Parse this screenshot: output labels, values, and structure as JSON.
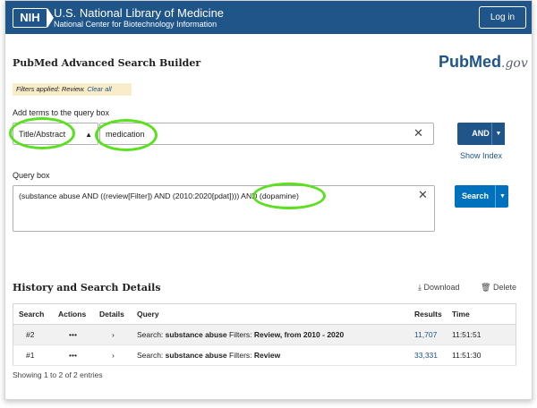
{
  "header": {
    "logo_text": "NIH",
    "title": "U.S. National Library of Medicine",
    "subtitle": "National Center for Biotechnology Information",
    "login_label": "Log in"
  },
  "builder": {
    "page_title": "PubMed Advanced Search Builder",
    "logo_pub": "Pub",
    "logo_med": "Med",
    "logo_gov": ".gov",
    "filters_applied": "Filters applied: Review.",
    "clear_all": "Clear all",
    "add_terms_label": "Add terms to the query box",
    "field_value": "Title/Abstract",
    "term_value": "medication",
    "operator_label": "AND",
    "show_index_label": "Show Index",
    "query_box_label": "Query box",
    "query_value": "(substance abuse AND ((review[Filter]) AND (2010:2020[pdat]))) AND (dopamine)",
    "search_label": "Search"
  },
  "history": {
    "title": "History and Search Details",
    "download_label": "Download",
    "delete_label": "Delete",
    "columns": [
      "Search",
      "Actions",
      "Details",
      "Query",
      "Results",
      "Time"
    ],
    "rows": [
      {
        "search": "#2",
        "actions": "•••",
        "details": "›",
        "query_prefix": "Search:",
        "query_term": "substance abuse",
        "filters_label": "Filters:",
        "filters": "Review, from 2010 - 2020",
        "results": "11,707",
        "time": "11:51:51"
      },
      {
        "search": "#1",
        "actions": "•••",
        "details": "›",
        "query_prefix": "Search:",
        "query_term": "substance abuse",
        "filters_label": "Filters:",
        "filters": "Review",
        "results": "33,331",
        "time": "11:51:30"
      }
    ],
    "showing": "Showing 1 to 2 of 2 entries"
  },
  "colors": {
    "header_bg": "#20558a",
    "annotation": "#5ae01f",
    "search_button": "#0071bc",
    "filters_bg": "#f9edc9"
  }
}
